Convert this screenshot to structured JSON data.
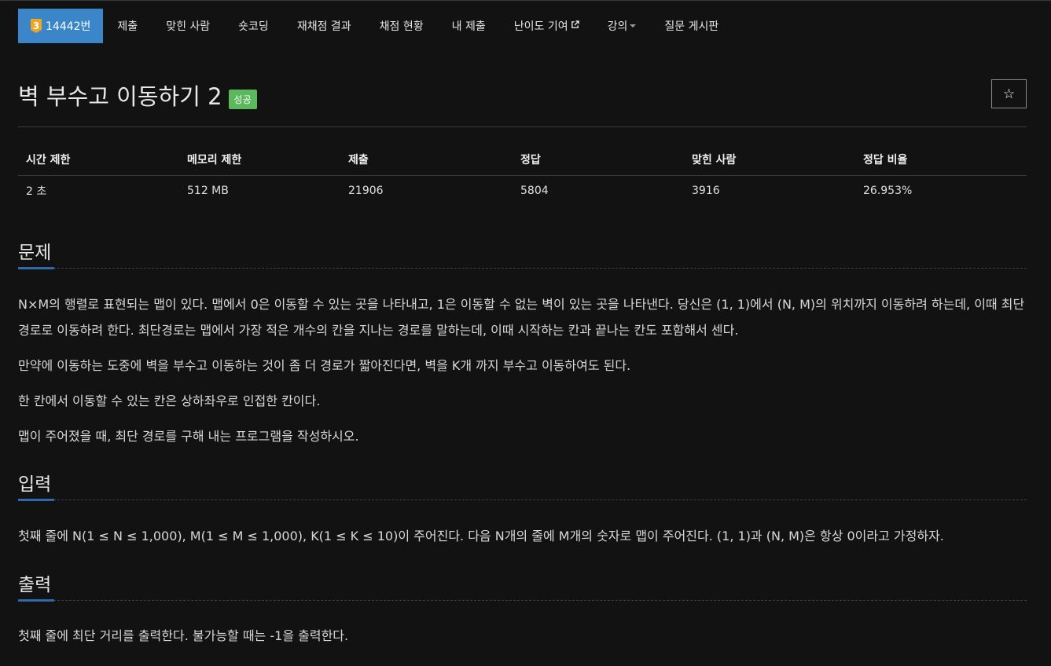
{
  "nav": {
    "tier_badge": "3",
    "problem_number": "14442번",
    "items": [
      "제출",
      "맞힌 사람",
      "숏코딩",
      "재채점 결과",
      "채점 현황",
      "내 제출",
      "난이도 기여",
      "강의",
      "질문 게시판"
    ],
    "external_icon": "external-link-icon",
    "caret_icon": "caret-down-icon"
  },
  "problem": {
    "title": "벽 부수고 이동하기 2",
    "status_badge": "성공",
    "star_glyph": "☆"
  },
  "info_table": {
    "headers": [
      "시간 제한",
      "메모리 제한",
      "제출",
      "정답",
      "맞힌 사람",
      "정답 비율"
    ],
    "values": [
      "2 초",
      "512 MB",
      "21906",
      "5804",
      "3916",
      "26.953%"
    ]
  },
  "sections": {
    "description": {
      "heading": "문제",
      "paragraphs": [
        "N×M의 행렬로 표현되는 맵이 있다. 맵에서 0은 이동할 수 있는 곳을 나타내고, 1은 이동할 수 없는 벽이 있는 곳을 나타낸다. 당신은 (1, 1)에서 (N, M)의 위치까지 이동하려 하는데, 이때 최단 경로로 이동하려 한다. 최단경로는 맵에서 가장 적은 개수의 칸을 지나는 경로를 말하는데, 이때 시작하는 칸과 끝나는 칸도 포함해서 센다.",
        "만약에 이동하는 도중에 벽을 부수고 이동하는 것이 좀 더 경로가 짧아진다면, 벽을 K개 까지 부수고 이동하여도 된다.",
        "한 칸에서 이동할 수 있는 칸은 상하좌우로 인접한 칸이다.",
        "맵이 주어졌을 때, 최단 경로를 구해 내는 프로그램을 작성하시오."
      ]
    },
    "input": {
      "heading": "입력",
      "text": "첫째 줄에 N(1 ≤ N ≤ 1,000), M(1 ≤ M ≤ 1,000), K(1 ≤ K ≤ 10)이 주어진다. 다음 N개의 줄에 M개의 숫자로 맵이 주어진다. (1, 1)과 (N, M)은 항상 0이라고 가정하자."
    },
    "output": {
      "heading": "출력",
      "text": "첫째 줄에 최단 거리를 출력한다. 불가능할 때는 -1을 출력한다."
    }
  },
  "colors": {
    "background": "#121212",
    "accent": "#3a86c8",
    "success": "#5cb85c",
    "tier_gold": "#f0a51e"
  }
}
